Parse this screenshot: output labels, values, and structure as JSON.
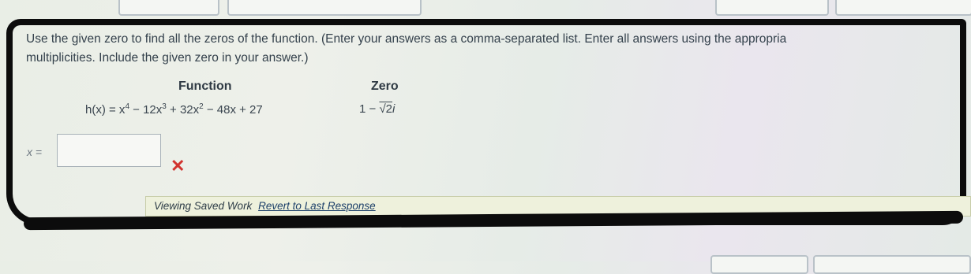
{
  "question": {
    "text": "Use the given zero to find all the zeros of the function. (Enter your answers as a comma-separated list. Enter all answers using the appropria",
    "text_line2": "multiplicities. Include the given zero in your answer.)"
  },
  "table": {
    "function_header": "Function",
    "zero_header": "Zero",
    "function_expr_prefix": "h(x) = x",
    "function_expr_parts": [
      "4",
      " − 12x",
      "3",
      " + 32x",
      "2",
      " − 48x + 27"
    ],
    "zero_expr_prefix": "1 − ",
    "zero_expr_sqrt": "√2",
    "zero_expr_suffix": "i"
  },
  "answer": {
    "label": "x =",
    "value": "",
    "status_mark": "✕"
  },
  "saved_work": {
    "text": "Viewing Saved Work",
    "revert_link": "Revert to Last Response"
  },
  "colors": {
    "wrong": "#d1332e",
    "annotation_stroke": "#0c0c0c"
  }
}
